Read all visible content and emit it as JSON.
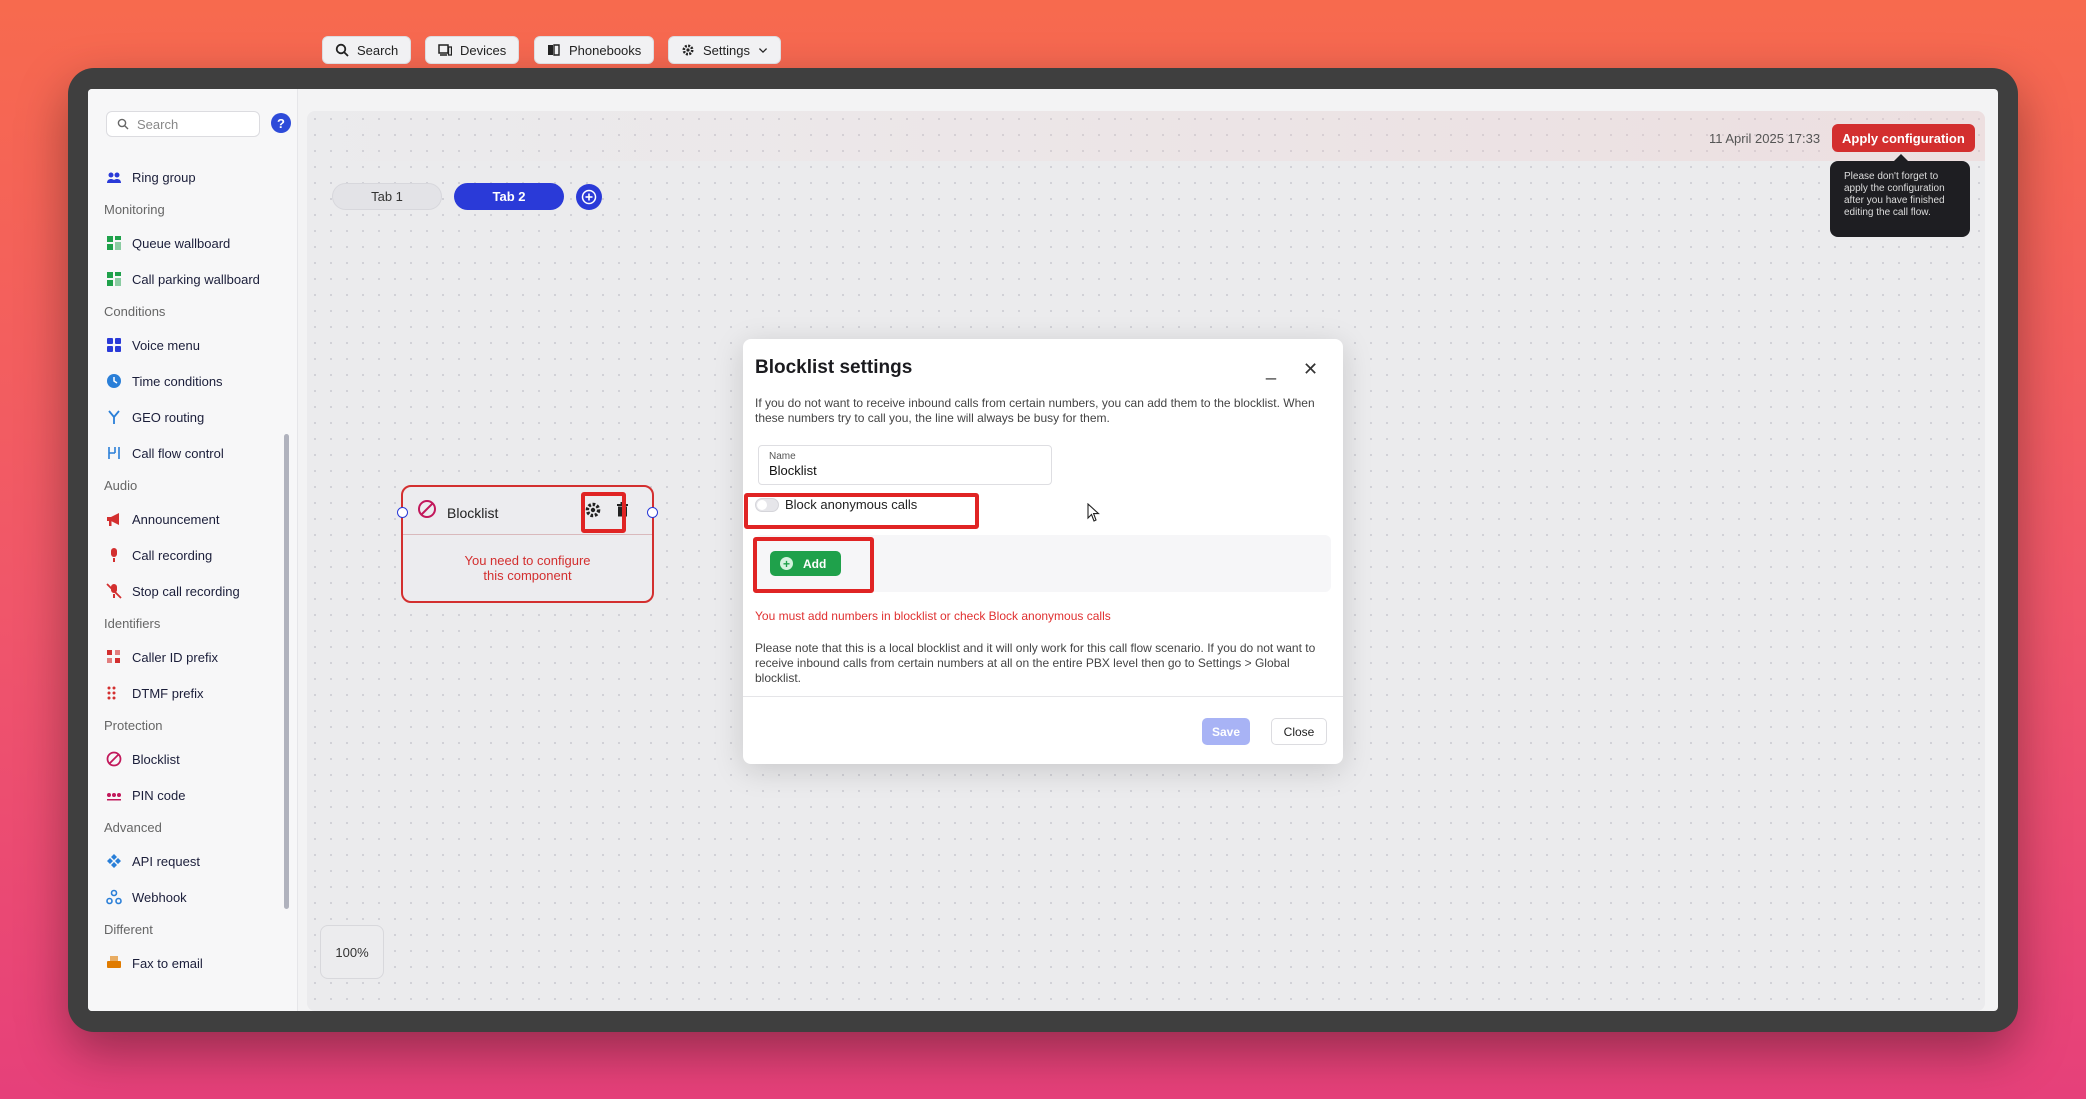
{
  "sidebar": {
    "search_placeholder": "Search",
    "help_label": "?",
    "sections": [
      {
        "title": "",
        "items": [
          {
            "label": "Ring group",
            "icon": "ring-group-icon",
            "color": "#2a3ad8"
          }
        ]
      },
      {
        "title": "Monitoring",
        "items": [
          {
            "label": "Queue wallboard",
            "icon": "wallboard-icon",
            "color": "#1fa14b"
          },
          {
            "label": "Call parking wallboard",
            "icon": "wallboard-icon",
            "color": "#1fa14b"
          }
        ]
      },
      {
        "title": "Conditions",
        "items": [
          {
            "label": "Voice menu",
            "icon": "voice-menu-icon",
            "color": "#2a3ad8"
          },
          {
            "label": "Time conditions",
            "icon": "clock-icon",
            "color": "#2a7fd8"
          },
          {
            "label": "GEO routing",
            "icon": "geo-routing-icon",
            "color": "#2a7fd8"
          },
          {
            "label": "Call flow control",
            "icon": "call-flow-control-icon",
            "color": "#2a7fd8"
          }
        ]
      },
      {
        "title": "Audio",
        "items": [
          {
            "label": "Announcement",
            "icon": "megaphone-icon",
            "color": "#d32f2f"
          },
          {
            "label": "Call recording",
            "icon": "microphone-icon",
            "color": "#d32f2f"
          },
          {
            "label": "Stop call recording",
            "icon": "microphone-off-icon",
            "color": "#d32f2f"
          }
        ]
      },
      {
        "title": "Identifiers",
        "items": [
          {
            "label": "Caller ID prefix",
            "icon": "caller-id-icon",
            "color": "#d32f2f"
          },
          {
            "label": "DTMF prefix",
            "icon": "dtmf-icon",
            "color": "#d32f2f"
          }
        ]
      },
      {
        "title": "Protection",
        "items": [
          {
            "label": "Blocklist",
            "icon": "block-icon",
            "color": "#c2185b"
          },
          {
            "label": "PIN code",
            "icon": "pin-code-icon",
            "color": "#c2185b"
          }
        ]
      },
      {
        "title": "Advanced",
        "items": [
          {
            "label": "API request",
            "icon": "api-icon",
            "color": "#2a7fd8"
          },
          {
            "label": "Webhook",
            "icon": "webhook-icon",
            "color": "#2a7fd8"
          }
        ]
      },
      {
        "title": "Different",
        "items": [
          {
            "label": "Fax to email",
            "icon": "fax-icon",
            "color": "#e07b00"
          }
        ]
      }
    ]
  },
  "toolbar": {
    "search_label": "Search",
    "devices_label": "Devices",
    "phonebooks_label": "Phonebooks",
    "settings_label": "Settings",
    "datetime": "11 April 2025 17:33",
    "apply_label": "Apply configuration",
    "tooltip": "Please don't forget to apply the configuration after you have finished editing the call flow."
  },
  "tabs": [
    {
      "label": "Tab 1",
      "active": false
    },
    {
      "label": "Tab 2",
      "active": true
    }
  ],
  "zoom": "100%",
  "node": {
    "title": "Blocklist",
    "message_line1": "You need to configure",
    "message_line2": "this component"
  },
  "modal": {
    "title": "Blocklist settings",
    "minimize": "_",
    "close": "✕",
    "description": "If you do not want to receive inbound calls from certain numbers, you can add them to the blocklist. When these numbers try to call you, the line will always be busy for them.",
    "name_label": "Name",
    "name_value": "Blocklist",
    "toggle_label": "Block anonymous calls",
    "toggle_on": false,
    "add_label": "Add",
    "error": "You must add numbers in blocklist or check Block anonymous calls",
    "note": "Please note that this is a local blocklist and it will only work for this call flow scenario. If you do not want to receive inbound calls from certain numbers at all on the entire PBX level then go to Settings > Global blocklist.",
    "save_label": "Save",
    "close_label": "Close"
  },
  "colors": {
    "accent": "#2a3ad8",
    "danger": "#d32f2f",
    "success": "#1fa14b"
  }
}
